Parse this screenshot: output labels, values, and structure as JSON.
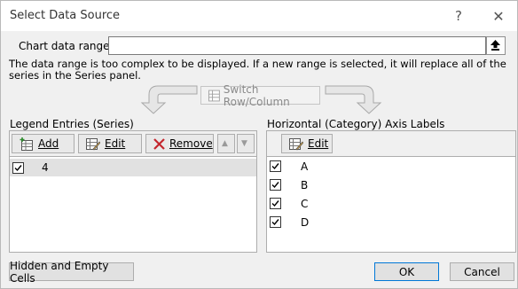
{
  "window": {
    "title": "Select Data Source",
    "help_glyph": "?",
    "close_glyph": "✕"
  },
  "range": {
    "label": "Chart data range:",
    "value": ""
  },
  "message": "The data range is too complex to be displayed. If a new range is selected, it will replace all of the series in the Series panel.",
  "switch_button": "Switch Row/Column",
  "legend": {
    "title": "Legend Entries (Series)",
    "add": "Add",
    "edit": "Edit",
    "remove": "Remove",
    "up_glyph": "▲",
    "down_glyph": "▼",
    "series": [
      {
        "name": "4",
        "checked": true
      }
    ]
  },
  "axis": {
    "title": "Horizontal (Category) Axis Labels",
    "edit": "Edit",
    "items": [
      {
        "label": "A",
        "checked": true
      },
      {
        "label": "B",
        "checked": true
      },
      {
        "label": "C",
        "checked": true
      },
      {
        "label": "D",
        "checked": true
      }
    ]
  },
  "footer": {
    "hidden": "Hidden and Empty Cells",
    "ok": "OK",
    "cancel": "Cancel"
  },
  "colors": {
    "accent": "#0078d7",
    "delete_red": "#c4262e",
    "selected_row": "#e1e1e1"
  }
}
